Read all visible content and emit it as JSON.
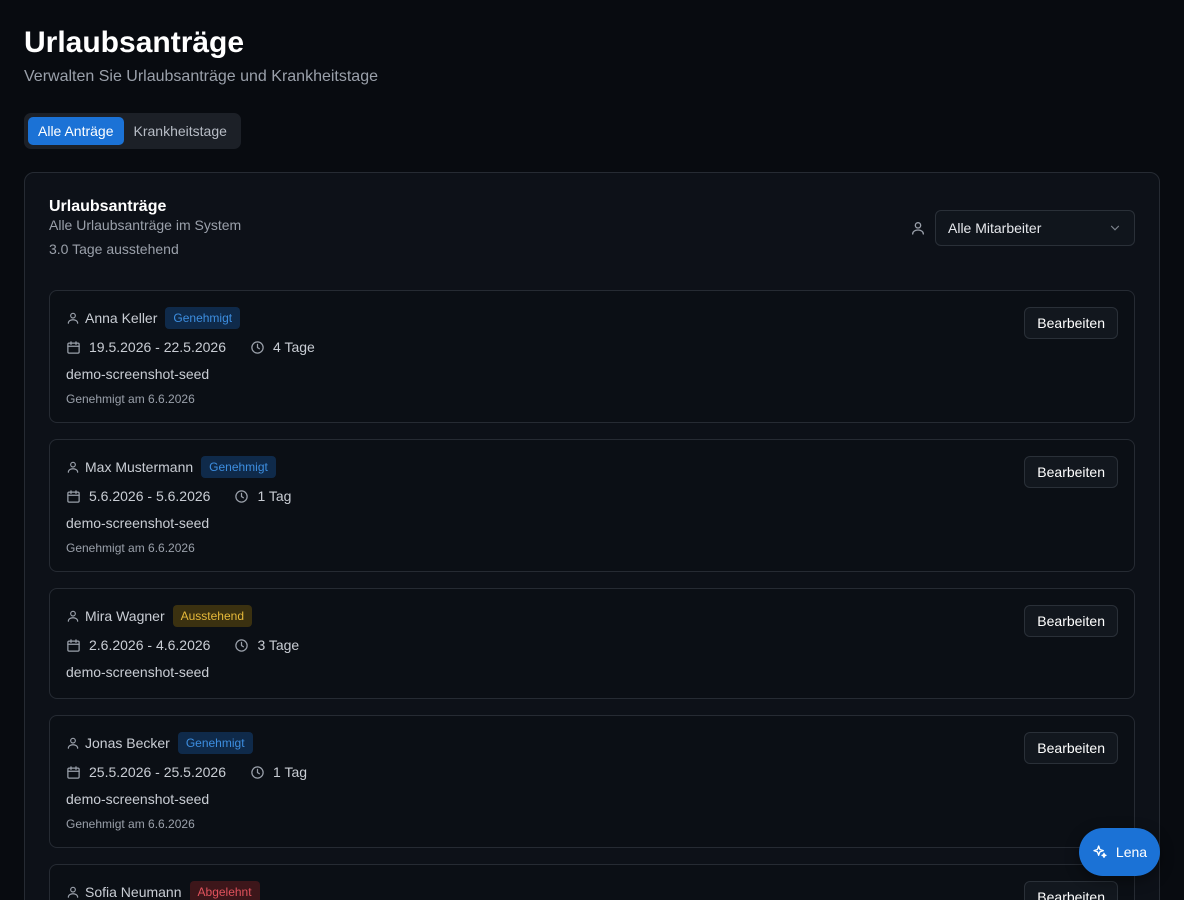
{
  "header": {
    "title": "Urlaubsanträge",
    "subtitle": "Verwalten Sie Urlaubsanträge und Krankheitstage"
  },
  "tabs": [
    {
      "label": "Alle Anträge",
      "active": true
    },
    {
      "label": "Krankheitstage",
      "active": false
    }
  ],
  "card": {
    "title": "Urlaubsanträge",
    "description": "Alle Urlaubsanträge im System",
    "pending": "3.0 Tage ausstehend",
    "filter": {
      "icon": "user-icon",
      "selected": "Alle Mitarbeiter"
    }
  },
  "requests": [
    {
      "name": "Anna Keller",
      "status": "Genehmigt",
      "status_type": "approved",
      "dates": "19.5.2026 - 22.5.2026",
      "duration": "4 Tage",
      "reason": "demo-screenshot-seed",
      "note": "Genehmigt am 6.6.2026",
      "action": "Bearbeiten"
    },
    {
      "name": "Max Mustermann",
      "status": "Genehmigt",
      "status_type": "approved",
      "dates": "5.6.2026 - 5.6.2026",
      "duration": "1 Tag",
      "reason": "demo-screenshot-seed",
      "note": "Genehmigt am 6.6.2026",
      "action": "Bearbeiten"
    },
    {
      "name": "Mira Wagner",
      "status": "Ausstehend",
      "status_type": "pending",
      "dates": "2.6.2026 - 4.6.2026",
      "duration": "3 Tage",
      "reason": "demo-screenshot-seed",
      "note": "",
      "action": "Bearbeiten"
    },
    {
      "name": "Jonas Becker",
      "status": "Genehmigt",
      "status_type": "approved",
      "dates": "25.5.2026 - 25.5.2026",
      "duration": "1 Tag",
      "reason": "demo-screenshot-seed",
      "note": "Genehmigt am 6.6.2026",
      "action": "Bearbeiten"
    },
    {
      "name": "Sofia Neumann",
      "status": "Abgelehnt",
      "status_type": "rejected",
      "dates": "",
      "duration": "",
      "reason": "",
      "note": "",
      "action": "Bearbeiten"
    }
  ],
  "assistant": {
    "label": "Lena",
    "icon": "sparkles-icon"
  },
  "colors": {
    "accent": "#1b72d6",
    "approved": "#3d8ee0",
    "pending": "#e6b93a",
    "rejected": "#e0525c"
  }
}
